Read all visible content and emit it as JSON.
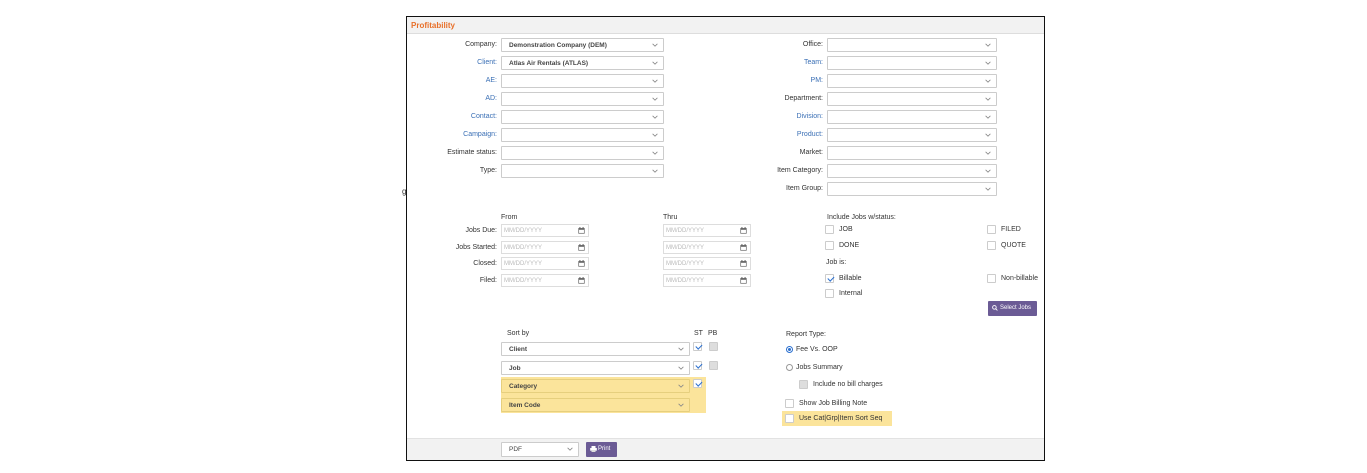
{
  "title": "Profitability",
  "left_fields": [
    {
      "label": "Company:",
      "value": "Demonstration Company (DEM)",
      "link": false
    },
    {
      "label": "Client:",
      "value": "Atlas Air Rentals (ATLAS)",
      "link": true
    },
    {
      "label": "AE:",
      "value": "",
      "link": true
    },
    {
      "label": "AD:",
      "value": "",
      "link": true
    },
    {
      "label": "Contact:",
      "value": "",
      "link": true
    },
    {
      "label": "Campaign:",
      "value": "",
      "link": true
    },
    {
      "label": "Estimate status:",
      "value": "",
      "link": false
    },
    {
      "label": "Type:",
      "value": "",
      "link": false
    }
  ],
  "right_fields": [
    {
      "label": "Office:",
      "value": "",
      "link": false
    },
    {
      "label": "Team:",
      "value": "",
      "link": true
    },
    {
      "label": "PM:",
      "value": "",
      "link": true
    },
    {
      "label": "Department:",
      "value": "",
      "link": false
    },
    {
      "label": "Division:",
      "value": "",
      "link": true
    },
    {
      "label": "Product:",
      "value": "",
      "link": true
    },
    {
      "label": "Market:",
      "value": "",
      "link": false
    },
    {
      "label": "Item Category:",
      "value": "",
      "link": false
    },
    {
      "label": "Item Group:",
      "value": "",
      "link": false
    }
  ],
  "dates": {
    "from_header": "From",
    "thru_header": "Thru",
    "placeholder": "MM/DD/YYYY",
    "rows": [
      "Jobs Due:",
      "Jobs Started:",
      "Closed:",
      "Filed:"
    ]
  },
  "status": {
    "header": "Include Jobs w/status:",
    "job": "JOB",
    "done": "DONE",
    "filed": "FILED",
    "quote": "QUOTE",
    "job_is": "Job is:",
    "billable": "Billable",
    "non_billable": "Non-billable",
    "internal": "Internal"
  },
  "select_jobs": "Select Jobs",
  "sort": {
    "header": "Sort by",
    "st": "ST",
    "pb": "PB",
    "rows": [
      "Client",
      "Job",
      "Category",
      "Item Code"
    ]
  },
  "report": {
    "header": "Report Type:",
    "fee_vs_oop": "Fee Vs. OOP",
    "jobs_summary": "Jobs Summary",
    "include_no_bill": "Include no bill charges",
    "show_billing_note": "Show Job Billing Note",
    "use_cat_grp": "Use Cat|Grp|Item Sort Seq"
  },
  "footer": {
    "format": "PDF",
    "print": "Print"
  },
  "colors": {
    "accent": "#e8702a",
    "link": "#3a6fb5",
    "highlight": "#fbe49b",
    "button": "#6b5b95"
  }
}
